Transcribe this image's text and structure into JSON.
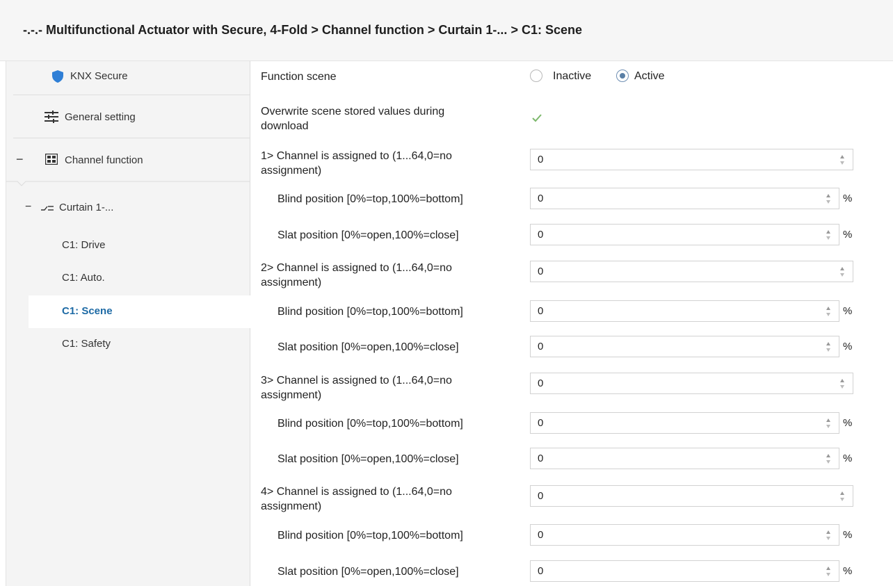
{
  "breadcrumb": {
    "device": "-.-.- Multifunctional Actuator with Secure, 4-Fold",
    "sep": ">",
    "level1": "Channel function",
    "level2": "Curtain 1-...",
    "level3": "C1: Scene"
  },
  "sidebar": {
    "knx_secure": "KNX Secure",
    "general_setting": "General setting",
    "channel_function": "Channel function",
    "curtain": "Curtain 1-...",
    "drive": "C1: Drive",
    "auto": "C1: Auto.",
    "scene": "C1: Scene",
    "safety": "C1: Safety",
    "collapse_symbol": "−"
  },
  "form": {
    "function_scene_label": "Function scene",
    "option_inactive": "Inactive",
    "option_active": "Active",
    "selected_option": "Active",
    "overwrite_label_line1": "Overwrite scene stored values during",
    "overwrite_label_line2": "download",
    "overwrite_checked": true,
    "unit": "%",
    "channels": [
      {
        "assign_line1": "1> Channel is assigned to (1...64,0=no",
        "assign_line2": "assignment)",
        "assign_value": "0",
        "blind_label": "Blind position [0%=top,100%=bottom]",
        "blind_value": "0",
        "slat_label": "Slat position [0%=open,100%=close]",
        "slat_value": "0"
      },
      {
        "assign_line1": "2> Channel is assigned to (1...64,0=no",
        "assign_line2": "assignment)",
        "assign_value": "0",
        "blind_label": "Blind position [0%=top,100%=bottom]",
        "blind_value": "0",
        "slat_label": "Slat position [0%=open,100%=close]",
        "slat_value": "0"
      },
      {
        "assign_line1": "3> Channel is assigned to (1...64,0=no",
        "assign_line2": "assignment)",
        "assign_value": "0",
        "blind_label": "Blind position [0%=top,100%=bottom]",
        "blind_value": "0",
        "slat_label": "Slat position [0%=open,100%=close]",
        "slat_value": "0"
      },
      {
        "assign_line1": "4> Channel is assigned to (1...64,0=no",
        "assign_line2": "assignment)",
        "assign_value": "0",
        "blind_label": "Blind position [0%=top,100%=bottom]",
        "blind_value": "0",
        "slat_label": "Slat position [0%=open,100%=close]",
        "slat_value": "0"
      }
    ]
  },
  "colors": {
    "accent": "#1d6aa5",
    "shield": "#2f7fd6",
    "check": "#7db86c",
    "radio_selected": "#5a7fa6"
  }
}
